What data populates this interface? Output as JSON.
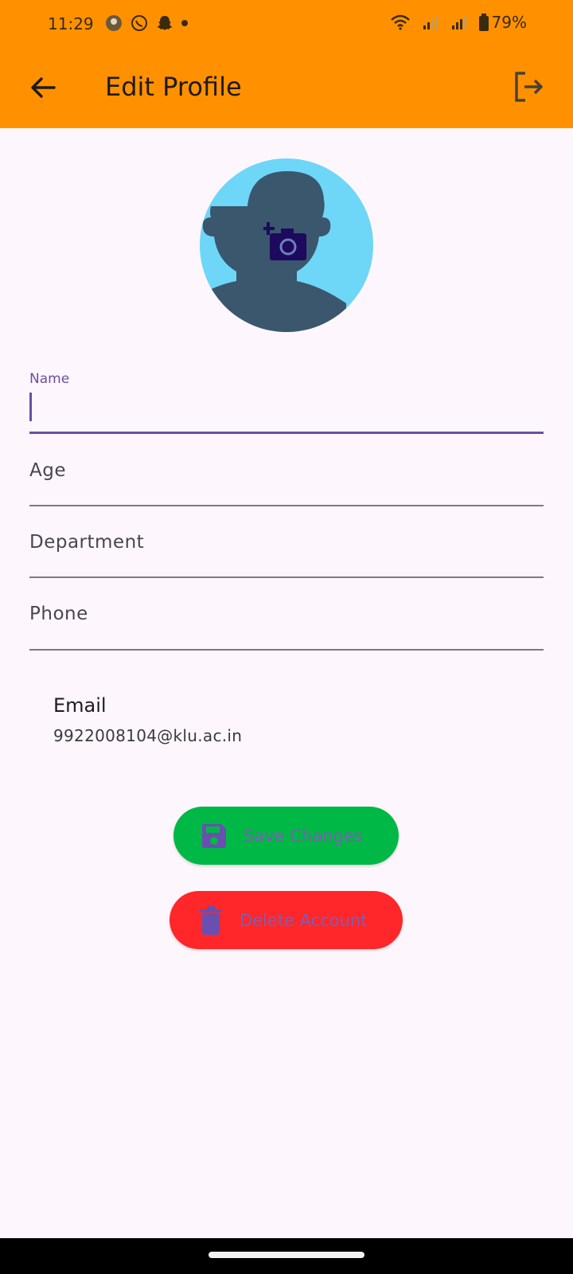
{
  "status_bar": {
    "time": "11:29",
    "battery": "79%"
  },
  "app_bar": {
    "title": "Edit Profile",
    "back_icon": "arrow-back-icon",
    "logout_icon": "logout-icon"
  },
  "avatar": {
    "icon": "add-photo-icon"
  },
  "form": {
    "name": {
      "label": "Name",
      "value": ""
    },
    "age": {
      "label": "Age",
      "value": ""
    },
    "department": {
      "label": "Department",
      "value": ""
    },
    "phone": {
      "label": "Phone",
      "value": ""
    }
  },
  "email": {
    "label": "Email",
    "value": "9922008104@klu.ac.in"
  },
  "buttons": {
    "save_label": "Save Changes",
    "delete_label": "Delete Account"
  },
  "colors": {
    "app_bar": "#ff9100",
    "accent": "#6a4fa3",
    "save": "#00b845",
    "delete": "#ff272a",
    "avatar_bg": "#6ed6f7"
  }
}
